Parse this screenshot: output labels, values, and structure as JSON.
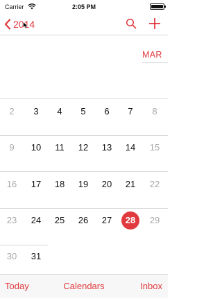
{
  "status_bar": {
    "carrier": "Carrier",
    "time": "2:05 PM"
  },
  "nav": {
    "back_label": "2014",
    "search_icon": "search-icon",
    "add_icon": "plus-icon"
  },
  "calendar": {
    "month_label": "MAR",
    "weeks": [
      [
        "2",
        "3",
        "4",
        "5",
        "6",
        "7",
        "8"
      ],
      [
        "9",
        "10",
        "11",
        "12",
        "13",
        "14",
        "15"
      ],
      [
        "16",
        "17",
        "18",
        "19",
        "20",
        "21",
        "22"
      ],
      [
        "23",
        "24",
        "25",
        "26",
        "27",
        "28",
        "29"
      ],
      [
        "30",
        "31"
      ]
    ],
    "today": "28"
  },
  "toolbar": {
    "today_label": "Today",
    "calendars_label": "Calendars",
    "inbox_label": "Inbox"
  },
  "colors": {
    "accent": "#e0393e",
    "weekend": "#a9a9a9",
    "divider": "#d7d7d7"
  }
}
